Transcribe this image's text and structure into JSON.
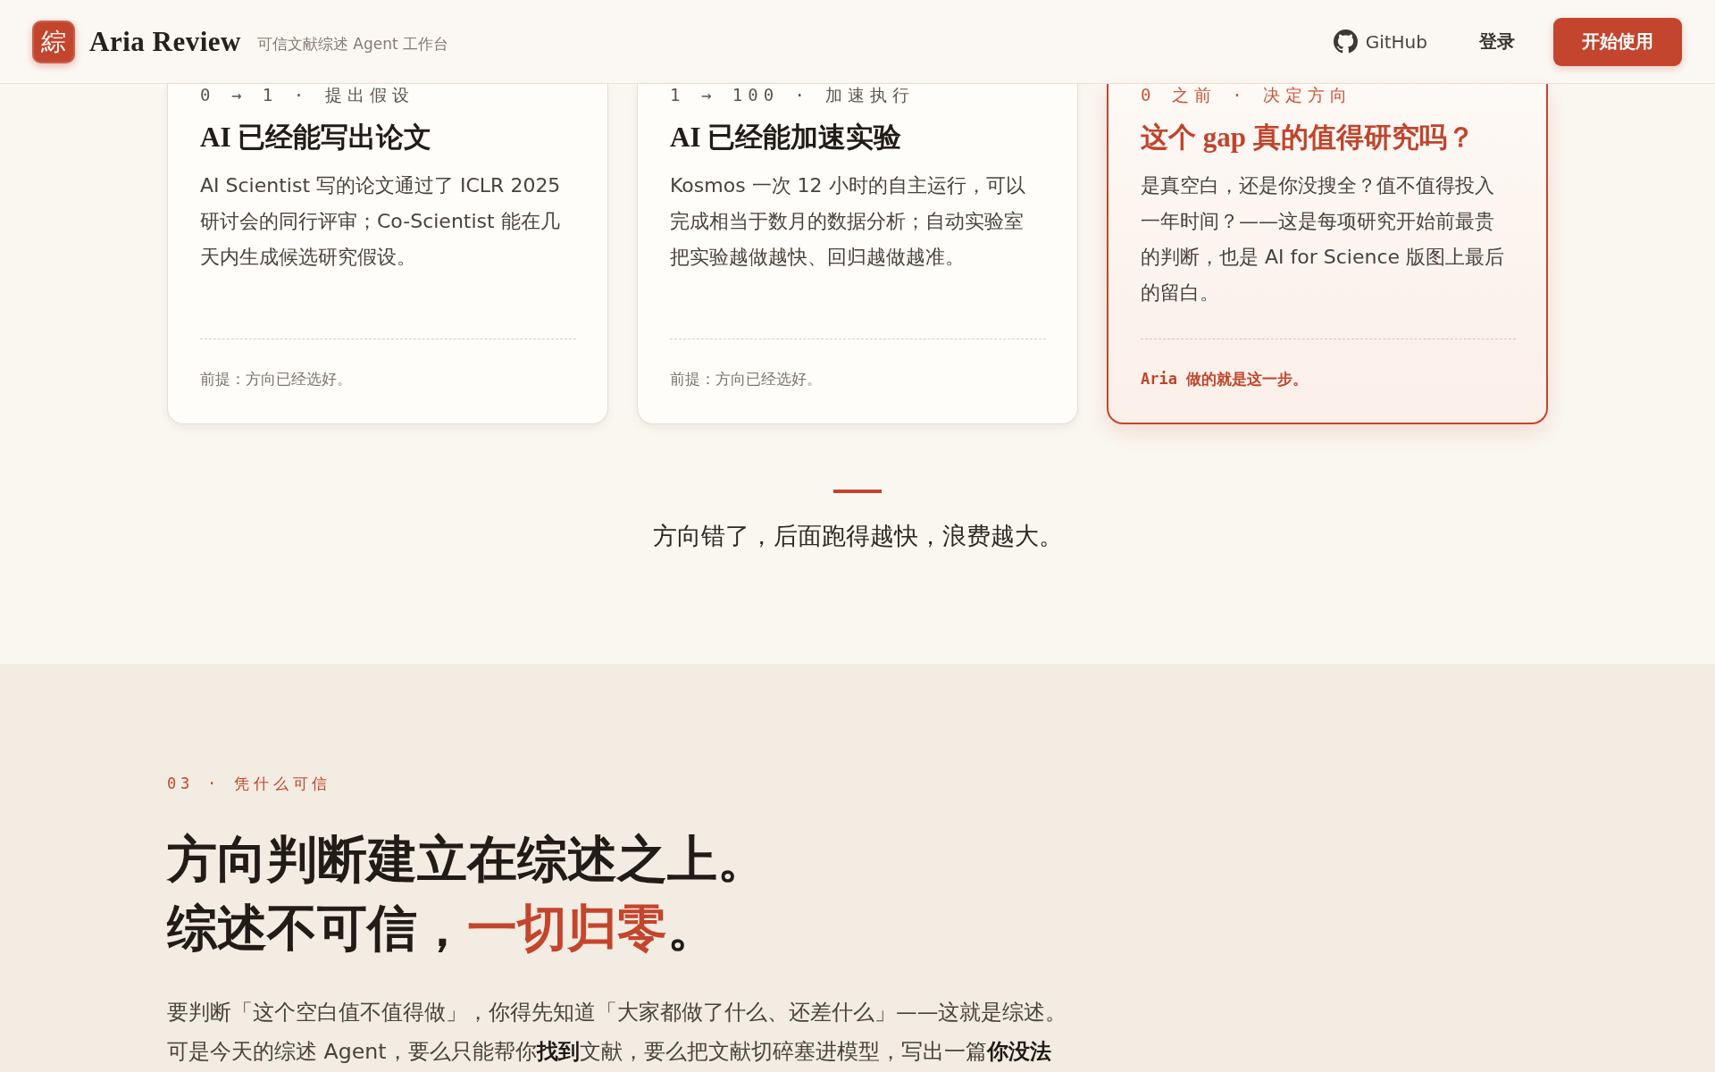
{
  "header": {
    "logo": "綜",
    "brand": "Aria Review",
    "tagline": "可信文献综述 Agent 工作台",
    "nav": [
      {
        "kind": "repo",
        "label": "GitHub"
      },
      {
        "kind": "link",
        "label": "登录"
      },
      {
        "kind": "primary",
        "label": "开始使用"
      }
    ]
  },
  "stages": [
    {
      "tag": "0 → 1 · 提出假设",
      "title": "AI 已经能写出论文",
      "body_lines": [
        "AI Scientist 写的论文通过了 ICLR 2025",
        "研讨会的同行评审；Co-Scientist 能在几",
        "天内生成候选研究假设。"
      ],
      "footnote": "前提：方向已经选好。",
      "highlighted": false
    },
    {
      "tag": "1 → 100 · 加速执行",
      "title": "AI 已经能加速实验",
      "body_lines": [
        "Kosmos 一次 12 小时的自主运行，可以",
        "完成相当于数月的数据分析；自动实验室",
        "把实验越做越快、回归越做越准。"
      ],
      "footnote": "前提：方向已经选好。",
      "highlighted": false
    },
    {
      "tag": "0 之前 · 决定方向",
      "title": "这个 gap 真的值得研究吗？",
      "body_lines": [
        "是真空白，还是你没搜全？值不值得投入",
        "一年时间？——这是每项研究开始前最贵",
        "的判断，也是 AI for Science 版图上最后",
        "的留白。"
      ],
      "footnote": "Aria 做的就是这一步。",
      "highlighted": true
    }
  ],
  "transition": {
    "text": "方向错了，后面跑得越快，浪费越大。"
  },
  "section": {
    "eyebrow": "03 · 凭什么可信",
    "heading_lines": [
      [
        {
          "text": "方向判断建立在综述之上。",
          "accent": false
        }
      ],
      [
        {
          "text": "综述不可信，",
          "accent": false
        },
        {
          "text": "一切归零",
          "accent": true
        },
        {
          "text": "。",
          "accent": false
        }
      ]
    ],
    "paragraph_lines": [
      "要判断「这个空白值不值得做」，你得先知道「大家都做了什么、还差什么」——这就是综述。",
      "可是今天的综述 Agent，要么只能帮你**找到**文献，要么把文献切碎塞进模型，写出一篇**你没法**"
    ]
  }
}
